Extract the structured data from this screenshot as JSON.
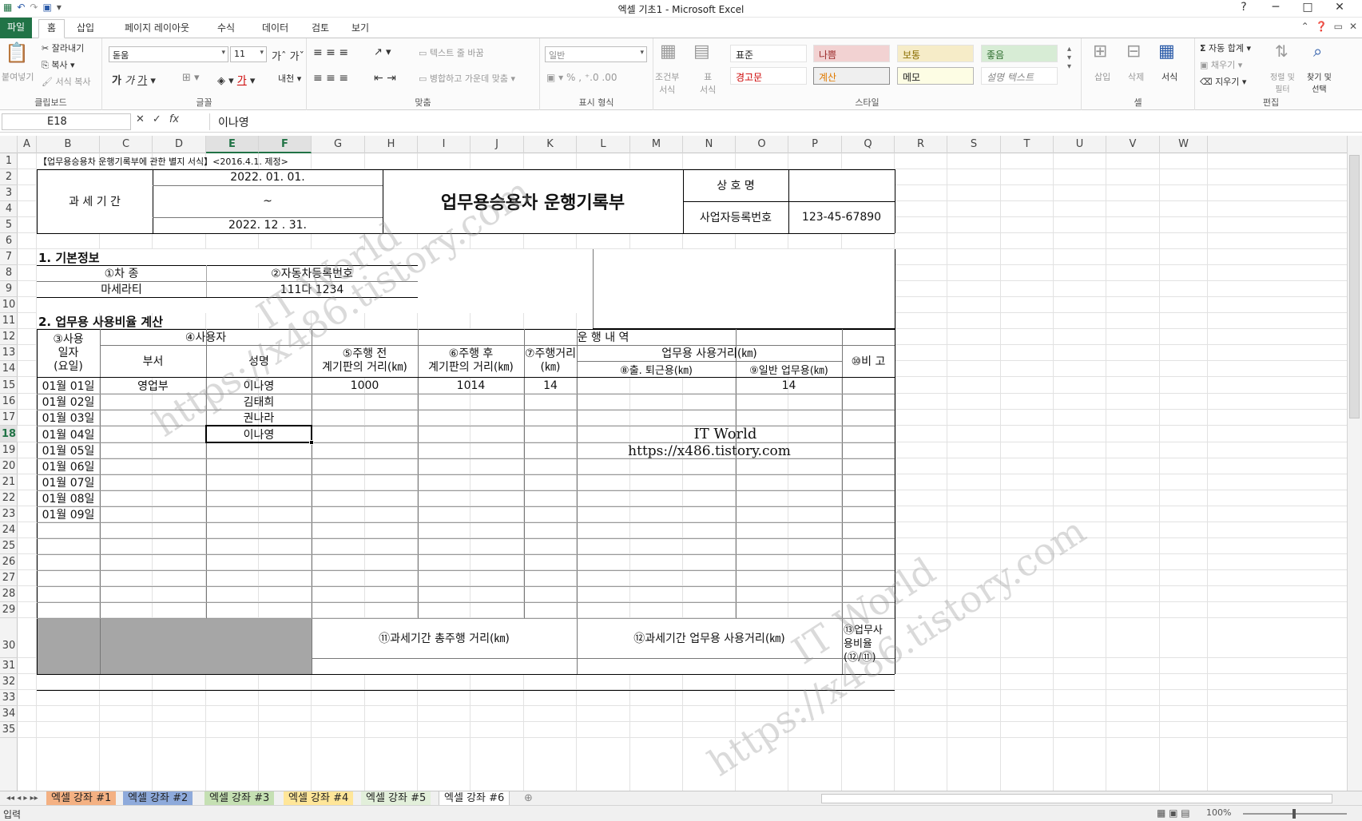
{
  "window": {
    "title": "엑셀 기초1 - Microsoft Excel",
    "controls": [
      "?",
      "─",
      "□",
      "✕"
    ]
  },
  "ribbon_tabs": [
    "파일",
    "홈",
    "삽입",
    "페이지 레이아웃",
    "수식",
    "데이터",
    "검토",
    "보기"
  ],
  "ribbon": {
    "clipboard": {
      "label": "클립보드",
      "paste": "붙여넣기",
      "cut": "잘라내기",
      "copy": "복사",
      "format_painter": "서식 복사"
    },
    "font": {
      "label": "글꼴",
      "name": "돋움",
      "size": "11"
    },
    "alignment": {
      "label": "맞춤",
      "wrap": "텍스트 줄 바꿈",
      "merge": "병합하고 가운데 맞춤"
    },
    "number": {
      "label": "표시 형식",
      "format": "일반"
    },
    "styles": {
      "label": "스타일",
      "conditional": "조건부\n서식",
      "table": "표\n서식",
      "cells": [
        "표준",
        "나쁨",
        "보통",
        "좋음",
        "경고문",
        "계산",
        "메모",
        "설명 텍스트"
      ]
    },
    "cells": {
      "label": "셀",
      "insert": "삽입",
      "delete": "삭제",
      "format": "서식"
    },
    "editing": {
      "label": "편집",
      "autosum": "자동 합계",
      "fill": "채우기",
      "clear": "지우기",
      "sort": "정렬 및\n필터",
      "find": "찾기 및\n선택"
    }
  },
  "formula_bar": {
    "name_box": "E18",
    "value": "이나영",
    "fx": "fx"
  },
  "columns": [
    "A",
    "B",
    "C",
    "D",
    "E",
    "F",
    "G",
    "H",
    "I",
    "J",
    "K",
    "L",
    "M",
    "N",
    "O",
    "P",
    "Q",
    "R",
    "S",
    "T",
    "U",
    "V",
    "W"
  ],
  "rows": [
    "1",
    "2",
    "3",
    "4",
    "5",
    "6",
    "7",
    "8",
    "9",
    "10",
    "11",
    "12",
    "13",
    "14",
    "15",
    "16",
    "17",
    "18",
    "19",
    "20",
    "21",
    "22",
    "23",
    "24",
    "25",
    "26",
    "27",
    "28",
    "29",
    "30",
    "31",
    "32",
    "33",
    "34",
    "35"
  ],
  "form": {
    "row1_note": "【업무용승용차 운행기록부에 관한 별지 서식】<2016.4.1. 제정>",
    "period_label": "과 세 기 간",
    "period_start": "2022. 01. 01.",
    "period_tilde": "~",
    "period_end": "2022.  12 .  31.",
    "main_title": "업무용승용차 운행기록부",
    "company_label": "상 호 명",
    "company_value": "",
    "biz_reg_label": "사업자등록번호",
    "biz_reg_value": "123-45-67890",
    "sec1_title": "1. 기본정보",
    "car_type_label": "①차 종",
    "car_reg_label": "②자동차등록번호",
    "car_type_value": "마세라티",
    "car_reg_value": "111다 1234",
    "sec2_title": "2. 업무용 사용비율 계산",
    "h_date": "③사용\n일자\n(요일)",
    "h_user": "④사용자",
    "h_dept": "부서",
    "h_name": "성명",
    "h_drive": "운 행     내 역",
    "h_before": "⑤주행 전\n계기판의 거리(㎞)",
    "h_after": "⑥주행 후\n계기판의 거리(㎞)",
    "h_dist": "⑦주행거리\n(㎞)",
    "h_biz": "업무용 사용거리(㎞)",
    "h_commute": "⑧출. 퇴근용(㎞)",
    "h_general": "⑨일반 업무용(㎞)",
    "h_note": "⑩비 고",
    "h_total": "⑪과세기간 총주행 거리(㎞)",
    "h_biz_total": "⑫과세기간 업무용 사용거리(㎞)",
    "h_ratio": "⑬업무사\n용비율\n(⑫/⑪)",
    "log": [
      {
        "date": "01월 01일",
        "dept": "영업부",
        "name": "이나영",
        "before": "1000",
        "after": "1014",
        "dist": "14",
        "general": "14"
      },
      {
        "date": "01월 02일",
        "dept": "",
        "name": "김태희",
        "before": "",
        "after": "",
        "dist": "",
        "general": ""
      },
      {
        "date": "01월 03일",
        "dept": "",
        "name": "권나라",
        "before": "",
        "after": "",
        "dist": "",
        "general": ""
      },
      {
        "date": "01월 04일",
        "dept": "",
        "name": "이나영",
        "before": "",
        "after": "",
        "dist": "",
        "general": ""
      },
      {
        "date": "01월 05일",
        "dept": "",
        "name": "",
        "before": "",
        "after": "",
        "dist": "",
        "general": ""
      },
      {
        "date": "01월 06일",
        "dept": "",
        "name": "",
        "before": "",
        "after": "",
        "dist": "",
        "general": ""
      },
      {
        "date": "01월 07일",
        "dept": "",
        "name": "",
        "before": "",
        "after": "",
        "dist": "",
        "general": ""
      },
      {
        "date": "01월 08일",
        "dept": "",
        "name": "",
        "before": "",
        "after": "",
        "dist": "",
        "general": ""
      },
      {
        "date": "01월 09일",
        "dept": "",
        "name": "",
        "before": "",
        "after": "",
        "dist": "",
        "general": ""
      }
    ],
    "watermark_center_1": "IT World",
    "watermark_center_2": "https://x486.tistory.com",
    "watermark_diag_1": "IT World",
    "watermark_diag_2": "https://x486.tistory.com"
  },
  "sheet_tabs": [
    "엑셀 강좌 #1",
    "엑셀 강좌 #2",
    "엑셀 강좌 #3",
    "엑셀 강좌 #4",
    "엑셀 강좌 #5",
    "엑셀 강좌 #6"
  ],
  "active_sheet": "엑셀 강좌 #6",
  "status": {
    "mode": "입력",
    "zoom": "100%"
  }
}
